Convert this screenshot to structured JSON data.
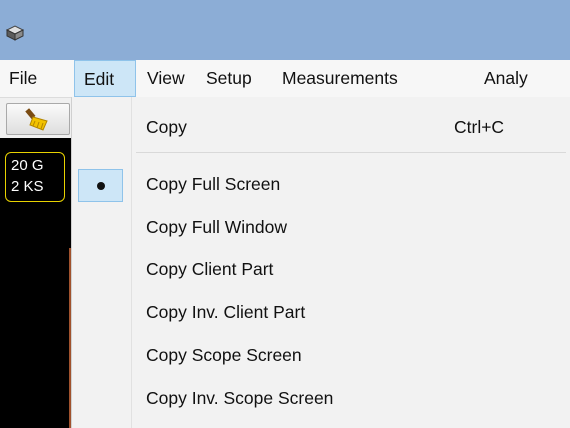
{
  "window": {
    "app_icon": "oscilloscope-app-icon",
    "titlebar_color": "#8cadd6"
  },
  "menubar": {
    "items": [
      {
        "label": "File"
      },
      {
        "label": "Edit"
      },
      {
        "label": "View"
      },
      {
        "label": "Setup"
      },
      {
        "label": "Measurements"
      },
      {
        "label": "Analy"
      }
    ],
    "active": "Edit"
  },
  "toolbar": {
    "clear_icon": "broom-icon"
  },
  "scope": {
    "info_lines": [
      "20 G",
      "2 KS"
    ],
    "border_color": "#e8d200"
  },
  "edit_menu": {
    "items": [
      {
        "label": "Copy",
        "shortcut": "Ctrl+C"
      },
      {
        "label": "Copy Full Screen",
        "checked": true
      },
      {
        "label": "Copy Full Window"
      },
      {
        "label": "Copy Client Part"
      },
      {
        "label": "Copy Inv. Client Part"
      },
      {
        "label": "Copy Scope Screen"
      },
      {
        "label": "Copy Inv. Scope Screen"
      }
    ]
  }
}
